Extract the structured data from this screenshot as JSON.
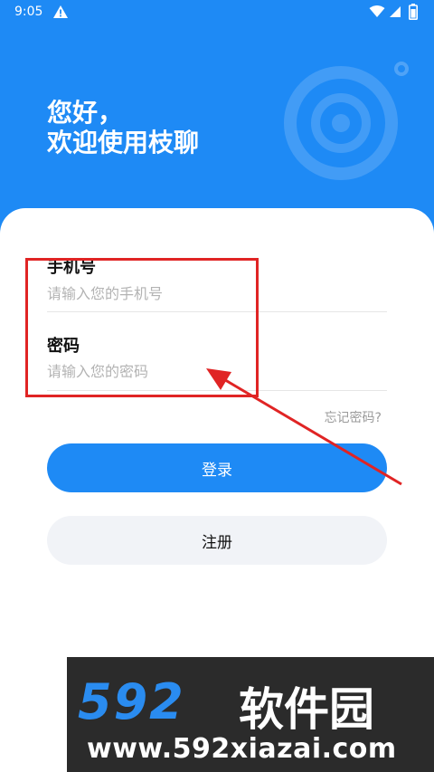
{
  "status_bar": {
    "time": "9:05"
  },
  "header": {
    "greeting_line1": "您好，",
    "greeting_line2": "欢迎使用枝聊"
  },
  "form": {
    "phone_label": "手机号",
    "phone_placeholder": "请输入您的手机号",
    "password_label": "密码",
    "password_placeholder": "请输入您的密码",
    "forgot_password": "忘记密码?"
  },
  "buttons": {
    "login": "登录",
    "register": "注册"
  },
  "watermark": {
    "number": "592",
    "name": "软件园",
    "url": "www.592xiazai.com"
  },
  "colors": {
    "primary": "#1E8AF5",
    "annotation": "#E02424"
  }
}
